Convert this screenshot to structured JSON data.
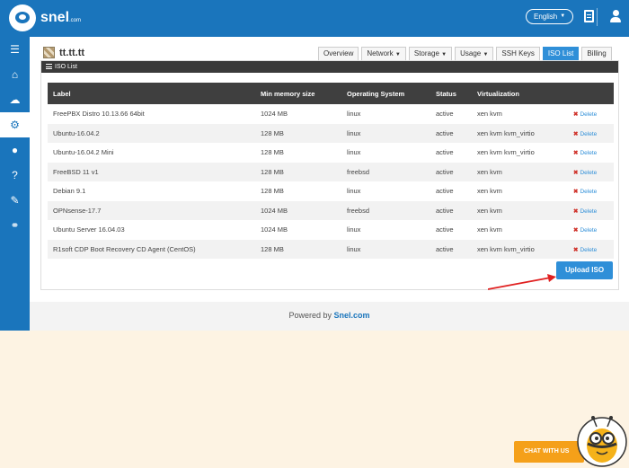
{
  "header": {
    "brand": "snel",
    "brand_suffix": ".com",
    "language": "English",
    "icons": [
      "document-icon",
      "user-icon"
    ]
  },
  "sidebar": {
    "icons": [
      "menu-icon",
      "home-icon",
      "cloud-icon",
      "gear-icon",
      "user-icon",
      "help-icon",
      "pencil-icon",
      "link-icon"
    ],
    "active_index": 3
  },
  "server": {
    "name": "tt.tt.tt"
  },
  "tabs": [
    {
      "label": "Overview",
      "dropdown": false
    },
    {
      "label": "Network",
      "dropdown": true
    },
    {
      "label": "Storage",
      "dropdown": true
    },
    {
      "label": "Usage",
      "dropdown": true
    },
    {
      "label": "SSH Keys",
      "dropdown": false
    },
    {
      "label": "ISO List",
      "dropdown": false,
      "active": true
    },
    {
      "label": "Billing",
      "dropdown": false
    }
  ],
  "panel": {
    "title": "ISO List"
  },
  "table": {
    "headers": [
      "Label",
      "Min memory size",
      "Operating System",
      "Status",
      "Virtualization",
      ""
    ],
    "action_label": "Delete",
    "rows": [
      [
        "FreePBX Distro 10.13.66 64bit",
        "1024 MB",
        "linux",
        "active",
        "xen kvm"
      ],
      [
        "Ubuntu-16.04.2",
        "128 MB",
        "linux",
        "active",
        "xen kvm kvm_virtio"
      ],
      [
        "Ubuntu-16.04.2 Mini",
        "128 MB",
        "linux",
        "active",
        "xen kvm kvm_virtio"
      ],
      [
        "FreeBSD 11 v1",
        "128 MB",
        "freebsd",
        "active",
        "xen kvm"
      ],
      [
        "Debian 9.1",
        "128 MB",
        "linux",
        "active",
        "xen kvm"
      ],
      [
        "OPNsense-17.7",
        "1024 MB",
        "freebsd",
        "active",
        "xen kvm"
      ],
      [
        "Ubuntu Server 16.04.03",
        "1024 MB",
        "linux",
        "active",
        "xen kvm"
      ],
      [
        "R1soft CDP Boot Recovery CD Agent (CentOS)",
        "128 MB",
        "linux",
        "active",
        "xen kvm kvm_virtio"
      ]
    ]
  },
  "upload_button": "Upload ISO",
  "footer": {
    "prefix": "Powered by",
    "brand": "Snel.com"
  },
  "chat": {
    "label": "CHAT WITH US"
  },
  "colors": {
    "primary": "#1a75bc",
    "accent": "#2f8fd8",
    "chat": "#f5a019",
    "delete_x": "#d0342c"
  }
}
